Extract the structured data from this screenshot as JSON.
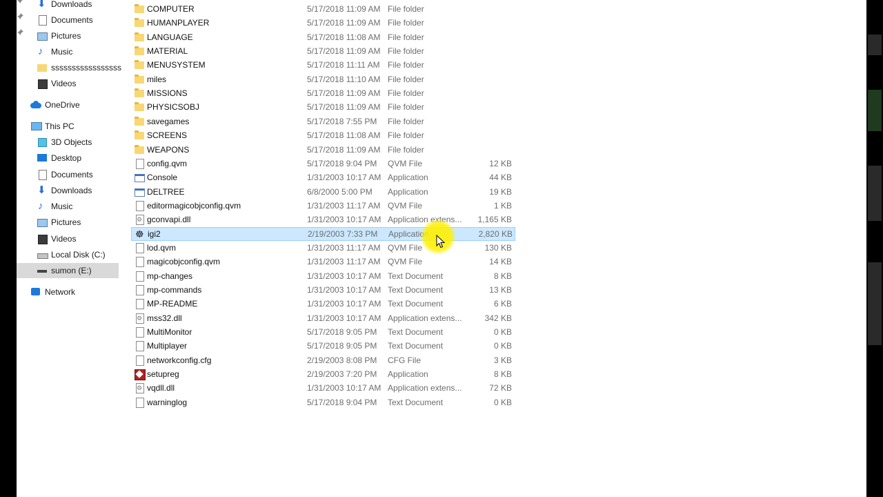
{
  "nav": {
    "quick_access": [
      {
        "label": "Downloads",
        "icon": "download-arrow-icon",
        "pinned": true
      },
      {
        "label": "Documents",
        "icon": "documents-icon",
        "pinned": true
      },
      {
        "label": "Pictures",
        "icon": "pictures-icon",
        "pinned": true
      },
      {
        "label": "Music",
        "icon": "music-icon",
        "pinned": false
      },
      {
        "label": "sssssssssssssssssssss",
        "icon": "folder-icon",
        "pinned": false
      },
      {
        "label": "Videos",
        "icon": "videos-icon",
        "pinned": false
      }
    ],
    "onedrive": {
      "label": "OneDrive",
      "icon": "cloud-icon"
    },
    "this_pc": {
      "label": "This PC",
      "icon": "computer-icon"
    },
    "this_pc_items": [
      {
        "label": "3D Objects",
        "icon": "3d-objects-icon"
      },
      {
        "label": "Desktop",
        "icon": "desktop-icon"
      },
      {
        "label": "Documents",
        "icon": "documents-icon"
      },
      {
        "label": "Downloads",
        "icon": "download-arrow-icon"
      },
      {
        "label": "Music",
        "icon": "music-icon"
      },
      {
        "label": "Pictures",
        "icon": "pictures-icon"
      },
      {
        "label": "Videos",
        "icon": "videos-icon"
      },
      {
        "label": "Local Disk (C:)",
        "icon": "hard-disk-icon"
      },
      {
        "label": "sumon (E:)",
        "icon": "usb-drive-icon",
        "selected": true
      }
    ],
    "network": {
      "label": "Network",
      "icon": "network-icon"
    }
  },
  "files": [
    {
      "name": "COMPUTER",
      "date": "5/17/2018 11:09 AM",
      "type": "File folder",
      "size": "",
      "icon": "folder"
    },
    {
      "name": "HUMANPLAYER",
      "date": "5/17/2018 11:09 AM",
      "type": "File folder",
      "size": "",
      "icon": "folder"
    },
    {
      "name": "LANGUAGE",
      "date": "5/17/2018 11:08 AM",
      "type": "File folder",
      "size": "",
      "icon": "folder"
    },
    {
      "name": "MATERIAL",
      "date": "5/17/2018 11:09 AM",
      "type": "File folder",
      "size": "",
      "icon": "folder"
    },
    {
      "name": "MENUSYSTEM",
      "date": "5/17/2018 11:11 AM",
      "type": "File folder",
      "size": "",
      "icon": "folder"
    },
    {
      "name": "miles",
      "date": "5/17/2018 11:10 AM",
      "type": "File folder",
      "size": "",
      "icon": "folder"
    },
    {
      "name": "MISSIONS",
      "date": "5/17/2018 11:09 AM",
      "type": "File folder",
      "size": "",
      "icon": "folder"
    },
    {
      "name": "PHYSICSOBJ",
      "date": "5/17/2018 11:09 AM",
      "type": "File folder",
      "size": "",
      "icon": "folder"
    },
    {
      "name": "savegames",
      "date": "5/17/2018 7:55 PM",
      "type": "File folder",
      "size": "",
      "icon": "folder"
    },
    {
      "name": "SCREENS",
      "date": "5/17/2018 11:08 AM",
      "type": "File folder",
      "size": "",
      "icon": "folder"
    },
    {
      "name": "WEAPONS",
      "date": "5/17/2018 11:09 AM",
      "type": "File folder",
      "size": "",
      "icon": "folder"
    },
    {
      "name": "config.qvm",
      "date": "5/17/2018 9:04 PM",
      "type": "QVM File",
      "size": "12 KB",
      "icon": "doc"
    },
    {
      "name": "Console",
      "date": "1/31/2003 10:17 AM",
      "type": "Application",
      "size": "44 KB",
      "icon": "app"
    },
    {
      "name": "DELTREE",
      "date": "6/8/2000 5:00 PM",
      "type": "Application",
      "size": "19 KB",
      "icon": "app"
    },
    {
      "name": "editormagicobjconfig.qvm",
      "date": "1/31/2003 11:17 AM",
      "type": "QVM File",
      "size": "1 KB",
      "icon": "doc"
    },
    {
      "name": "gconvapi.dll",
      "date": "1/31/2003 10:17 AM",
      "type": "Application extens...",
      "size": "1,165 KB",
      "icon": "dll"
    },
    {
      "name": "igi2",
      "date": "2/19/2003 7:33 PM",
      "type": "Application",
      "size": "2,820 KB",
      "icon": "game",
      "selected": true
    },
    {
      "name": "lod.qvm",
      "date": "1/31/2003 11:17 AM",
      "type": "QVM File",
      "size": "130 KB",
      "icon": "doc"
    },
    {
      "name": "magicobjconfig.qvm",
      "date": "1/31/2003 11:17 AM",
      "type": "QVM File",
      "size": "14 KB",
      "icon": "doc"
    },
    {
      "name": "mp-changes",
      "date": "1/31/2003 10:17 AM",
      "type": "Text Document",
      "size": "8 KB",
      "icon": "doc"
    },
    {
      "name": "mp-commands",
      "date": "1/31/2003 10:17 AM",
      "type": "Text Document",
      "size": "13 KB",
      "icon": "doc"
    },
    {
      "name": "MP-README",
      "date": "1/31/2003 10:17 AM",
      "type": "Text Document",
      "size": "6 KB",
      "icon": "doc"
    },
    {
      "name": "mss32.dll",
      "date": "1/31/2003 10:17 AM",
      "type": "Application extens...",
      "size": "342 KB",
      "icon": "dll"
    },
    {
      "name": "MultiMonitor",
      "date": "5/17/2018 9:05 PM",
      "type": "Text Document",
      "size": "0 KB",
      "icon": "doc"
    },
    {
      "name": "Multiplayer",
      "date": "5/17/2018 9:05 PM",
      "type": "Text Document",
      "size": "0 KB",
      "icon": "doc"
    },
    {
      "name": "networkconfig.cfg",
      "date": "2/19/2003 8:08 PM",
      "type": "CFG File",
      "size": "3 KB",
      "icon": "doc"
    },
    {
      "name": "setupreg",
      "date": "2/19/2003 7:20 PM",
      "type": "Application",
      "size": "8 KB",
      "icon": "setup"
    },
    {
      "name": "vqdll.dll",
      "date": "1/31/2003 10:17 AM",
      "type": "Application extens...",
      "size": "72 KB",
      "icon": "dll"
    },
    {
      "name": "warninglog",
      "date": "5/17/2018 9:04 PM",
      "type": "Text Document",
      "size": "0 KB",
      "icon": "doc"
    }
  ],
  "colors": {
    "selection_bg": "#cce8ff",
    "selection_border": "#99d1ff",
    "nav_selected_bg": "#d9d9d9",
    "cursor_highlight": "#fff000"
  }
}
